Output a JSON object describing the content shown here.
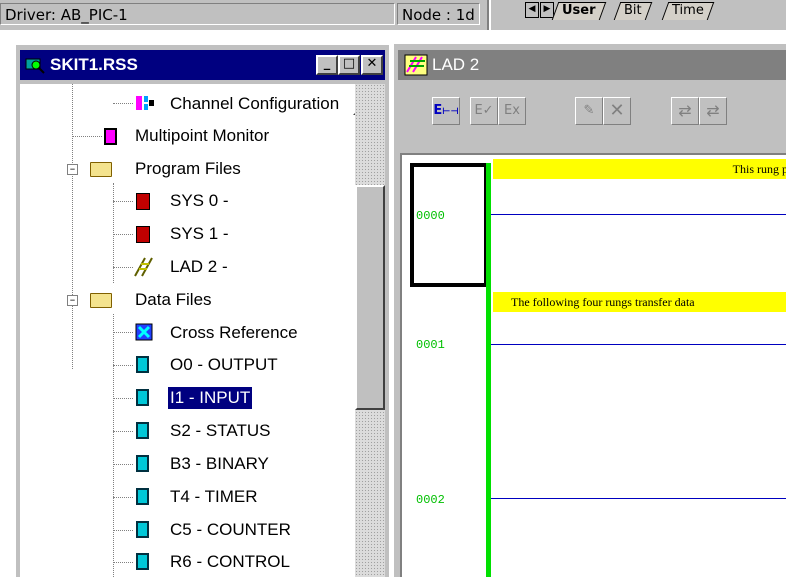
{
  "status_bar": {
    "driver": "Driver: AB_PIC-1",
    "node": "Node : 1d",
    "tabs": [
      "User",
      "Bit",
      "Time"
    ]
  },
  "project_window": {
    "title": "SKIT1.RSS",
    "buttons": {
      "minimize": "_",
      "maximize": "□",
      "close": "✕"
    },
    "tree": [
      {
        "label": "Channel Configuration",
        "icon": "channel-config-icon"
      },
      {
        "label": "Multipoint Monitor",
        "icon": "monitor-icon"
      },
      {
        "label": "Program Files",
        "icon": "folder-icon",
        "expanded": true
      },
      {
        "label": "SYS 0 -",
        "icon": "program-file-icon"
      },
      {
        "label": "SYS 1 -",
        "icon": "program-file-icon"
      },
      {
        "label": "LAD 2 -",
        "icon": "ladder-file-icon"
      },
      {
        "label": "Data Files",
        "icon": "folder-icon",
        "expanded": true
      },
      {
        "label": "Cross Reference",
        "icon": "cross-reference-icon"
      },
      {
        "label": "O0 - OUTPUT",
        "icon": "data-file-icon"
      },
      {
        "label": "I1 - INPUT",
        "icon": "data-file-icon",
        "selected": true
      },
      {
        "label": "S2 - STATUS",
        "icon": "data-file-icon"
      },
      {
        "label": "B3 - BINARY",
        "icon": "data-file-icon"
      },
      {
        "label": "T4 - TIMER",
        "icon": "data-file-icon"
      },
      {
        "label": "C5 - COUNTER",
        "icon": "data-file-icon"
      },
      {
        "label": "R6 - CONTROL",
        "icon": "data-file-icon"
      }
    ]
  },
  "ladder_window": {
    "title": "LAD 2",
    "toolbar": [
      {
        "name": "insert-rung",
        "glyph": "E"
      },
      {
        "name": "edit-rung",
        "glyph": "E"
      },
      {
        "name": "cancel-edit",
        "glyph": "E"
      },
      {
        "name": "accept",
        "glyph": "✎"
      },
      {
        "name": "delete",
        "glyph": "✕"
      },
      {
        "name": "test-edits",
        "glyph": "⇄"
      },
      {
        "name": "assemble-edits",
        "glyph": "⇄"
      }
    ],
    "rungs": [
      {
        "number": "0000",
        "comment": "This rung p"
      },
      {
        "number": "0001",
        "comment": "The following four rungs transfer data"
      },
      {
        "number": "0002",
        "comment": ""
      }
    ]
  },
  "colors": {
    "title_active": "#000080",
    "title_inactive": "#808080",
    "rail": "#00e000",
    "rung_line": "#0000c0",
    "comment_bg": "#ffff00"
  }
}
